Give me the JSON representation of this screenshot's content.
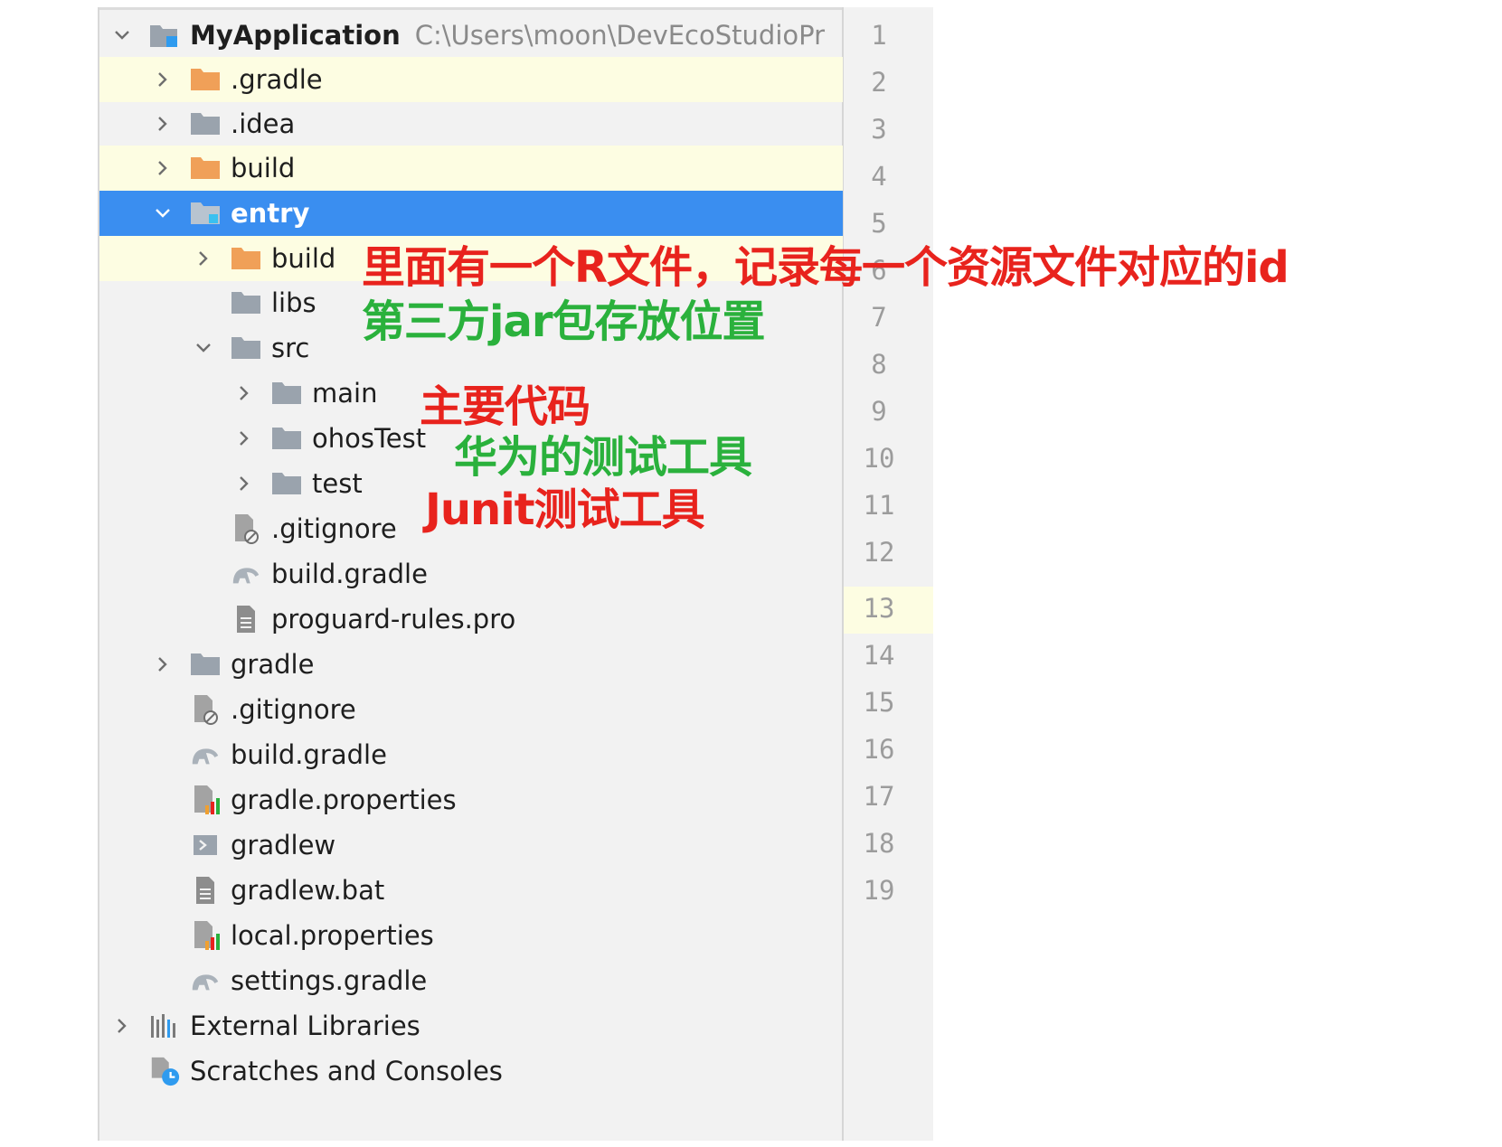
{
  "tree": {
    "root": {
      "label": "MyApplication",
      "path": "C:\\Users\\moon\\DevEcoStudioPr"
    },
    "rows": [
      {
        "label": ".gradle"
      },
      {
        "label": ".idea"
      },
      {
        "label": "build"
      },
      {
        "label": "entry"
      },
      {
        "label": "build"
      },
      {
        "label": "libs"
      },
      {
        "label": "src"
      },
      {
        "label": "main"
      },
      {
        "label": "ohosTest"
      },
      {
        "label": "test"
      },
      {
        "label": ".gitignore"
      },
      {
        "label": "build.gradle"
      },
      {
        "label": "proguard-rules.pro"
      },
      {
        "label": "gradle"
      },
      {
        "label": ".gitignore"
      },
      {
        "label": "build.gradle"
      },
      {
        "label": "gradle.properties"
      },
      {
        "label": "gradlew"
      },
      {
        "label": "gradlew.bat"
      },
      {
        "label": "local.properties"
      },
      {
        "label": "settings.gradle"
      },
      {
        "label": "External Libraries"
      },
      {
        "label": "Scratches and Consoles"
      }
    ]
  },
  "gutter": {
    "line_numbers": [
      "1",
      "2",
      "3",
      "4",
      "5",
      "6",
      "7",
      "8",
      "9",
      "10",
      "11",
      "12",
      "13",
      "14",
      "15",
      "16",
      "17",
      "18",
      "19"
    ]
  },
  "annotations": {
    "r_file": "里面有一个R文件，记录每一个资源文件对应的id",
    "libs": "第三方jar包存放位置",
    "main": "主要代码",
    "ohos_test": "华为的测试工具",
    "test": "Junit测试工具"
  },
  "colors": {
    "selection": "#3a8ef0",
    "highlight_row": "#fdfde2",
    "folder_orange": "#f0a058",
    "folder_gray": "#9aa3ad",
    "annotation_red": "#e8231d",
    "annotation_green": "#2ab13c"
  }
}
